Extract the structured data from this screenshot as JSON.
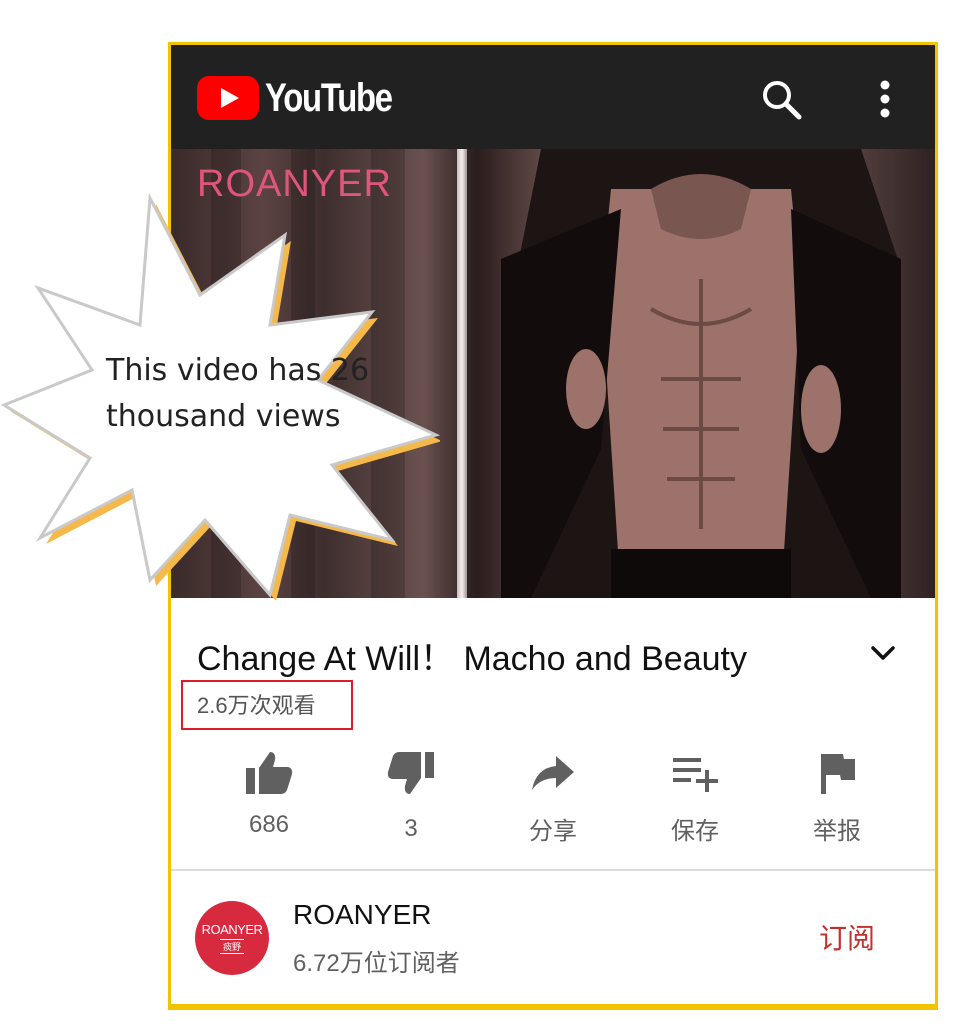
{
  "header": {
    "logo_text": "YouTube",
    "icons": [
      "search-icon",
      "more-vert-icon"
    ]
  },
  "video": {
    "watermark": "ROANYER",
    "title": "Change At Will！ Macho and Beauty",
    "views": "2.6万次观看"
  },
  "actions": [
    {
      "icon": "thumb-up-icon",
      "label": "686"
    },
    {
      "icon": "thumb-down-icon",
      "label": "3"
    },
    {
      "icon": "share-icon",
      "label": "分享"
    },
    {
      "icon": "playlist-add-icon",
      "label": "保存"
    },
    {
      "icon": "flag-icon",
      "label": "举报"
    }
  ],
  "channel": {
    "avatar_text": "ROANYER",
    "avatar_subtext": "痰野",
    "name": "ROANYER",
    "subscribers": "6.72万位订阅者",
    "subscribe_label": "订阅"
  },
  "annotation": {
    "callout": "This video has 26 thousand views"
  },
  "colors": {
    "frame": "#f2c400",
    "highlight": "#d91e2a",
    "brand_red": "#ff0000",
    "subscribe": "#c4302b"
  }
}
